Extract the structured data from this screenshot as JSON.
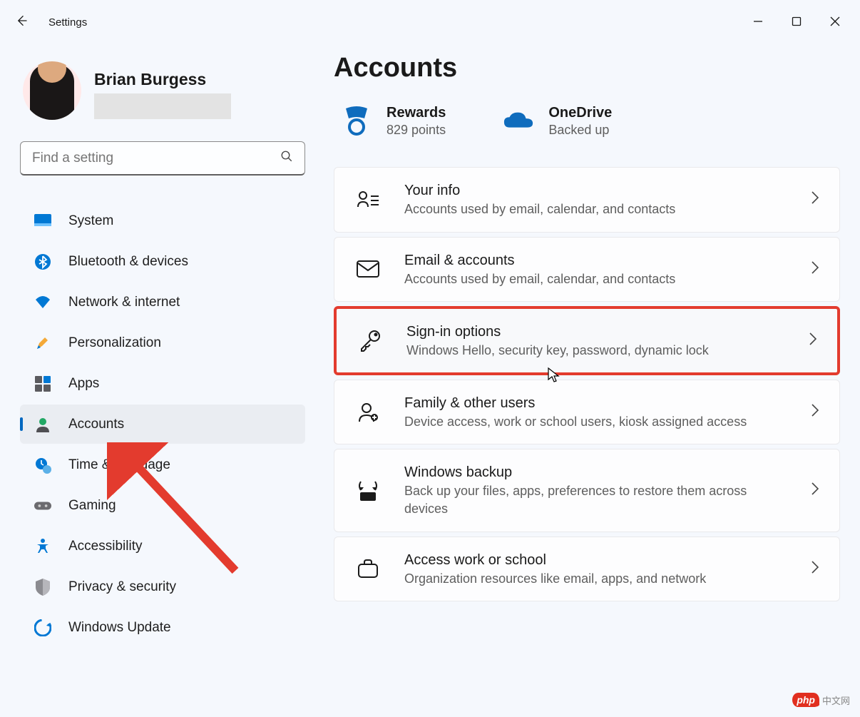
{
  "window": {
    "title": "Settings"
  },
  "profile": {
    "name": "Brian Burgess"
  },
  "search": {
    "placeholder": "Find a setting"
  },
  "nav": {
    "items": [
      {
        "label": "System"
      },
      {
        "label": "Bluetooth & devices"
      },
      {
        "label": "Network & internet"
      },
      {
        "label": "Personalization"
      },
      {
        "label": "Apps"
      },
      {
        "label": "Accounts"
      },
      {
        "label": "Time & language"
      },
      {
        "label": "Gaming"
      },
      {
        "label": "Accessibility"
      },
      {
        "label": "Privacy & security"
      },
      {
        "label": "Windows Update"
      }
    ]
  },
  "page": {
    "title": "Accounts"
  },
  "tiles": {
    "rewards": {
      "title": "Rewards",
      "sub": "829 points"
    },
    "onedrive": {
      "title": "OneDrive",
      "sub": "Backed up"
    }
  },
  "rows": [
    {
      "title": "Your info",
      "sub": "Accounts used by email, calendar, and contacts"
    },
    {
      "title": "Email & accounts",
      "sub": "Accounts used by email, calendar, and contacts"
    },
    {
      "title": "Sign-in options",
      "sub": "Windows Hello, security key, password, dynamic lock"
    },
    {
      "title": "Family & other users",
      "sub": "Device access, work or school users, kiosk assigned access"
    },
    {
      "title": "Windows backup",
      "sub": "Back up your files, apps, preferences to restore them across devices"
    },
    {
      "title": "Access work or school",
      "sub": "Organization resources like email, apps, and network"
    }
  ],
  "watermark": {
    "logo": "php",
    "text": "中文网"
  }
}
